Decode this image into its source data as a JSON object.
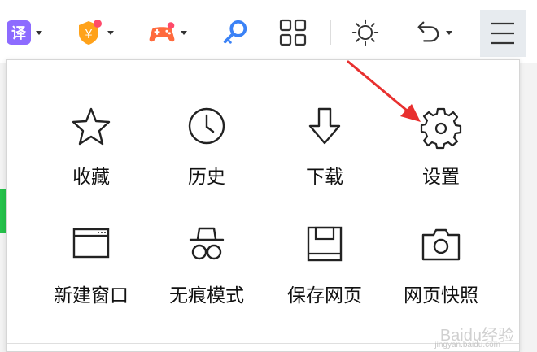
{
  "toolbar": {
    "translate_glyph": "译",
    "buttons": [
      {
        "name": "translate-icon",
        "has_caret": true
      },
      {
        "name": "coupon-icon",
        "has_caret": true
      },
      {
        "name": "game-icon",
        "has_caret": true
      },
      {
        "name": "key-icon",
        "has_caret": false
      },
      {
        "name": "grid-icon",
        "has_caret": false
      },
      {
        "name": "brightness-icon",
        "has_caret": false
      },
      {
        "name": "undo-icon",
        "has_caret": true
      },
      {
        "name": "hamburger-menu-icon",
        "has_caret": false
      }
    ],
    "coupon_glyph": "¥"
  },
  "menu": {
    "items": [
      {
        "label": "收藏",
        "icon": "star-icon"
      },
      {
        "label": "历史",
        "icon": "clock-icon"
      },
      {
        "label": "下载",
        "icon": "download-arrow-icon"
      },
      {
        "label": "设置",
        "icon": "gear-icon"
      },
      {
        "label": "新建窗口",
        "icon": "window-icon"
      },
      {
        "label": "无痕模式",
        "icon": "incognito-icon"
      },
      {
        "label": "保存网页",
        "icon": "save-page-icon"
      },
      {
        "label": "网页快照",
        "icon": "camera-icon"
      }
    ]
  },
  "watermark": {
    "text": "Baidu经验",
    "sub": "jingyan.baidu.com"
  },
  "colors": {
    "accent_purple": "#8d6bff",
    "annotation_red": "#e8302f",
    "key_blue": "#3b82f6"
  }
}
